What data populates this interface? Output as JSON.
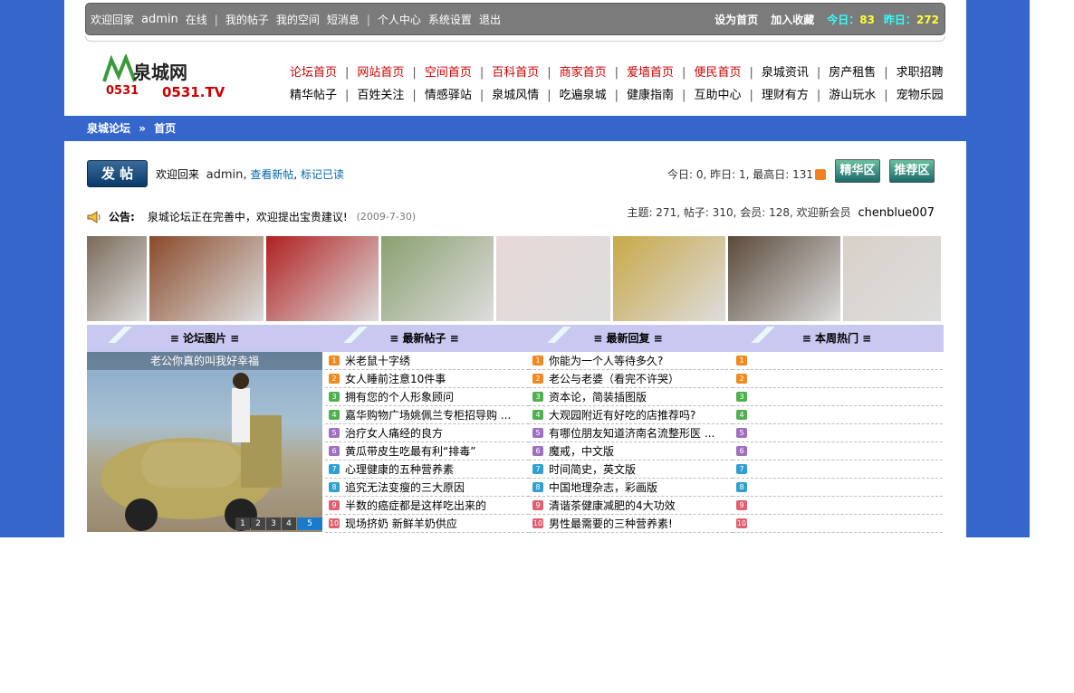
{
  "topbar": {
    "welcome": "欢迎回家",
    "username": "admin",
    "online": "在线",
    "my_posts": "我的帖子",
    "my_space": "我的空间",
    "short_msg": "短消息",
    "user_center": "个人中心",
    "settings": "系统设置",
    "logout": "退出",
    "set_home": "设为首页",
    "add_fav": "加入收藏",
    "today_label": "今日：",
    "today_value": "83",
    "yesterday_label": "昨日：",
    "yesterday_value": "272"
  },
  "logo": {
    "name": "泉城网",
    "domain": "0531.TV",
    "number_mark": "0531"
  },
  "nav": {
    "row1": [
      {
        "label": "论坛首页",
        "red": true
      },
      {
        "label": "网站首页",
        "red": true
      },
      {
        "label": "空间首页",
        "red": true
      },
      {
        "label": "百科首页",
        "red": true
      },
      {
        "label": "商家首页",
        "red": true
      },
      {
        "label": "爱墙首页",
        "red": true
      },
      {
        "label": "便民首页",
        "red": true
      },
      {
        "label": "泉城资讯",
        "red": false
      },
      {
        "label": "房产租售",
        "red": false
      },
      {
        "label": "求职招聘",
        "red": false
      }
    ],
    "row2": [
      {
        "label": "精华帖子"
      },
      {
        "label": "百姓关注"
      },
      {
        "label": "情感驿站"
      },
      {
        "label": "泉城风情"
      },
      {
        "label": "吃遍泉城"
      },
      {
        "label": "健康指南"
      },
      {
        "label": "互助中心"
      },
      {
        "label": "理财有方"
      },
      {
        "label": "游山玩水"
      },
      {
        "label": "宠物乐园"
      }
    ]
  },
  "breadcrumb": {
    "forum": "泉城论坛",
    "arrow": "»",
    "page": "首页"
  },
  "post_bar": {
    "post_button": "发 帖",
    "welcome_back": "欢迎回来",
    "user": "admin,",
    "view_new": "查看新帖",
    "comma": ",",
    "mark_read": "标记已读",
    "stats": "今日: 0, 昨日: 1, 最高日: 131",
    "essence_zone": "精华区",
    "recommend_zone": "推荐区"
  },
  "notice": {
    "label": "公告:",
    "text": "泉城论坛正在完善中，欢迎提出宝贵建议!",
    "date": "(2009-7-30)",
    "member_stats": "主题: 271, 帖子: 310, 会员: 128, 欢迎新会员",
    "new_member": "chenblue007"
  },
  "photos": [
    {
      "name": "roast-photo",
      "color": "#7a6a58"
    },
    {
      "name": "meat-dish-photo",
      "color": "#8a4a2a"
    },
    {
      "name": "restaurant-sign-photo",
      "color": "#b02020"
    },
    {
      "name": "car-woman-photo",
      "color": "#8aa070"
    },
    {
      "name": "mickey-card-photo",
      "color": "#e8d8d8"
    },
    {
      "name": "salad-photo",
      "color": "#c8a848"
    },
    {
      "name": "stone-photo",
      "color": "#5a4a3a"
    },
    {
      "name": "legs-photo",
      "color": "#d8d0c8"
    }
  ],
  "columns": {
    "pictures": "≡ 论坛图片 ≡",
    "latest_posts": "≡ 最新帖子 ≡",
    "latest_replies": "≡ 最新回复 ≡",
    "weekly_hot": "≡ 本周热门 ≡"
  },
  "feature": {
    "caption": "老公你真的叫我好幸福",
    "pages": [
      "1",
      "2",
      "3",
      "4",
      "5"
    ]
  },
  "latest_posts": [
    "米老鼠十字绣",
    "女人睡前注意10件事",
    "拥有您的个人形象顾问",
    "嘉华购物广场姚佩兰专柜招导购 ...",
    "治疗女人痛经的良方",
    "黄瓜带皮生吃最有利“排毒”",
    "心理健康的五种营养素",
    "追究无法变瘦的三大原因",
    "半数的癌症都是这样吃出来的",
    "现场挤奶 新鲜羊奶供应"
  ],
  "latest_replies": [
    "你能为一个人等待多久?",
    "老公与老婆（看完不许哭）",
    "资本论，简装插图版",
    "大观园附近有好吃的店推荐吗?",
    "有哪位朋友知道济南名流整形医 ...",
    "魔戒，中文版",
    "时间简史，英文版",
    "中国地理杂志，彩画版",
    "清谐茶健康减肥的4大功效",
    "男性最需要的三种营养素!"
  ],
  "weekly_hot": [
    "",
    "",
    "",
    "",
    "",
    "",
    "",
    "",
    "",
    ""
  ],
  "rank_colors": [
    "#f08a20",
    "#f08a20",
    "#50b050",
    "#50b050",
    "#a070c0",
    "#a070c0",
    "#30a0d0",
    "#30a0d0",
    "#e06070",
    "#e06070"
  ]
}
